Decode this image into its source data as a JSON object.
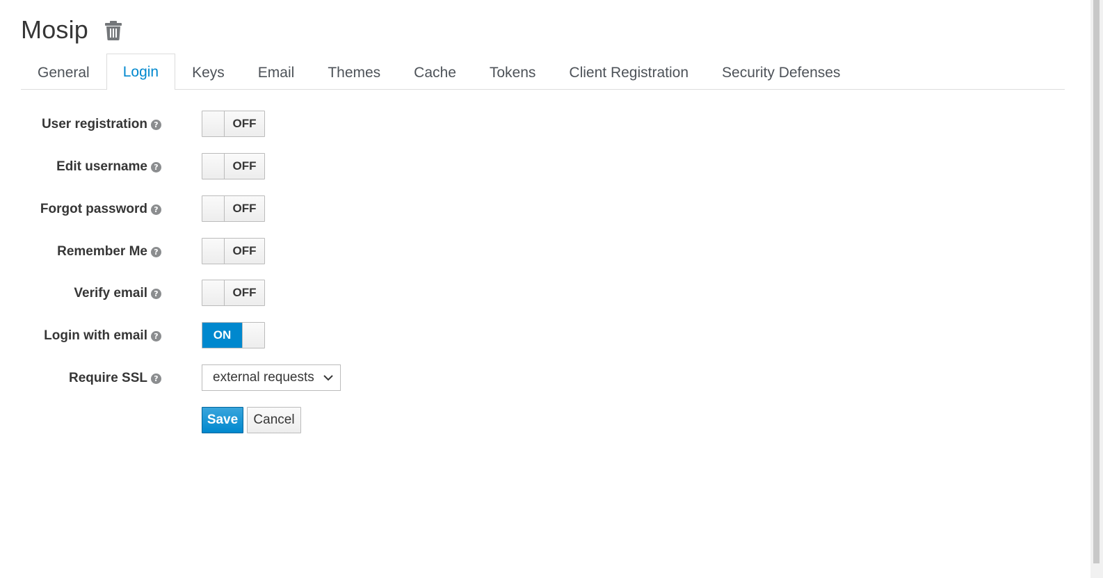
{
  "realm": {
    "title": "Mosip"
  },
  "tabs": [
    {
      "label": "General",
      "active": false
    },
    {
      "label": "Login",
      "active": true
    },
    {
      "label": "Keys",
      "active": false
    },
    {
      "label": "Email",
      "active": false
    },
    {
      "label": "Themes",
      "active": false
    },
    {
      "label": "Cache",
      "active": false
    },
    {
      "label": "Tokens",
      "active": false
    },
    {
      "label": "Client Registration",
      "active": false
    },
    {
      "label": "Security Defenses",
      "active": false
    }
  ],
  "settings": [
    {
      "label": "User registration",
      "state": "OFF"
    },
    {
      "label": "Edit username",
      "state": "OFF"
    },
    {
      "label": "Forgot password",
      "state": "OFF"
    },
    {
      "label": "Remember Me",
      "state": "OFF"
    },
    {
      "label": "Verify email",
      "state": "OFF"
    },
    {
      "label": "Login with email",
      "state": "ON"
    }
  ],
  "require_ssl": {
    "label": "Require SSL",
    "value": "external requests"
  },
  "actions": {
    "save_label": "Save",
    "cancel_label": "Cancel"
  },
  "icons": {
    "delete": "trash-icon",
    "help": "question-circle-icon",
    "dropdown": "chevron-down-icon"
  },
  "colors": {
    "accent": "#0088ce",
    "text": "#363636",
    "tab_text": "#4d5258"
  }
}
